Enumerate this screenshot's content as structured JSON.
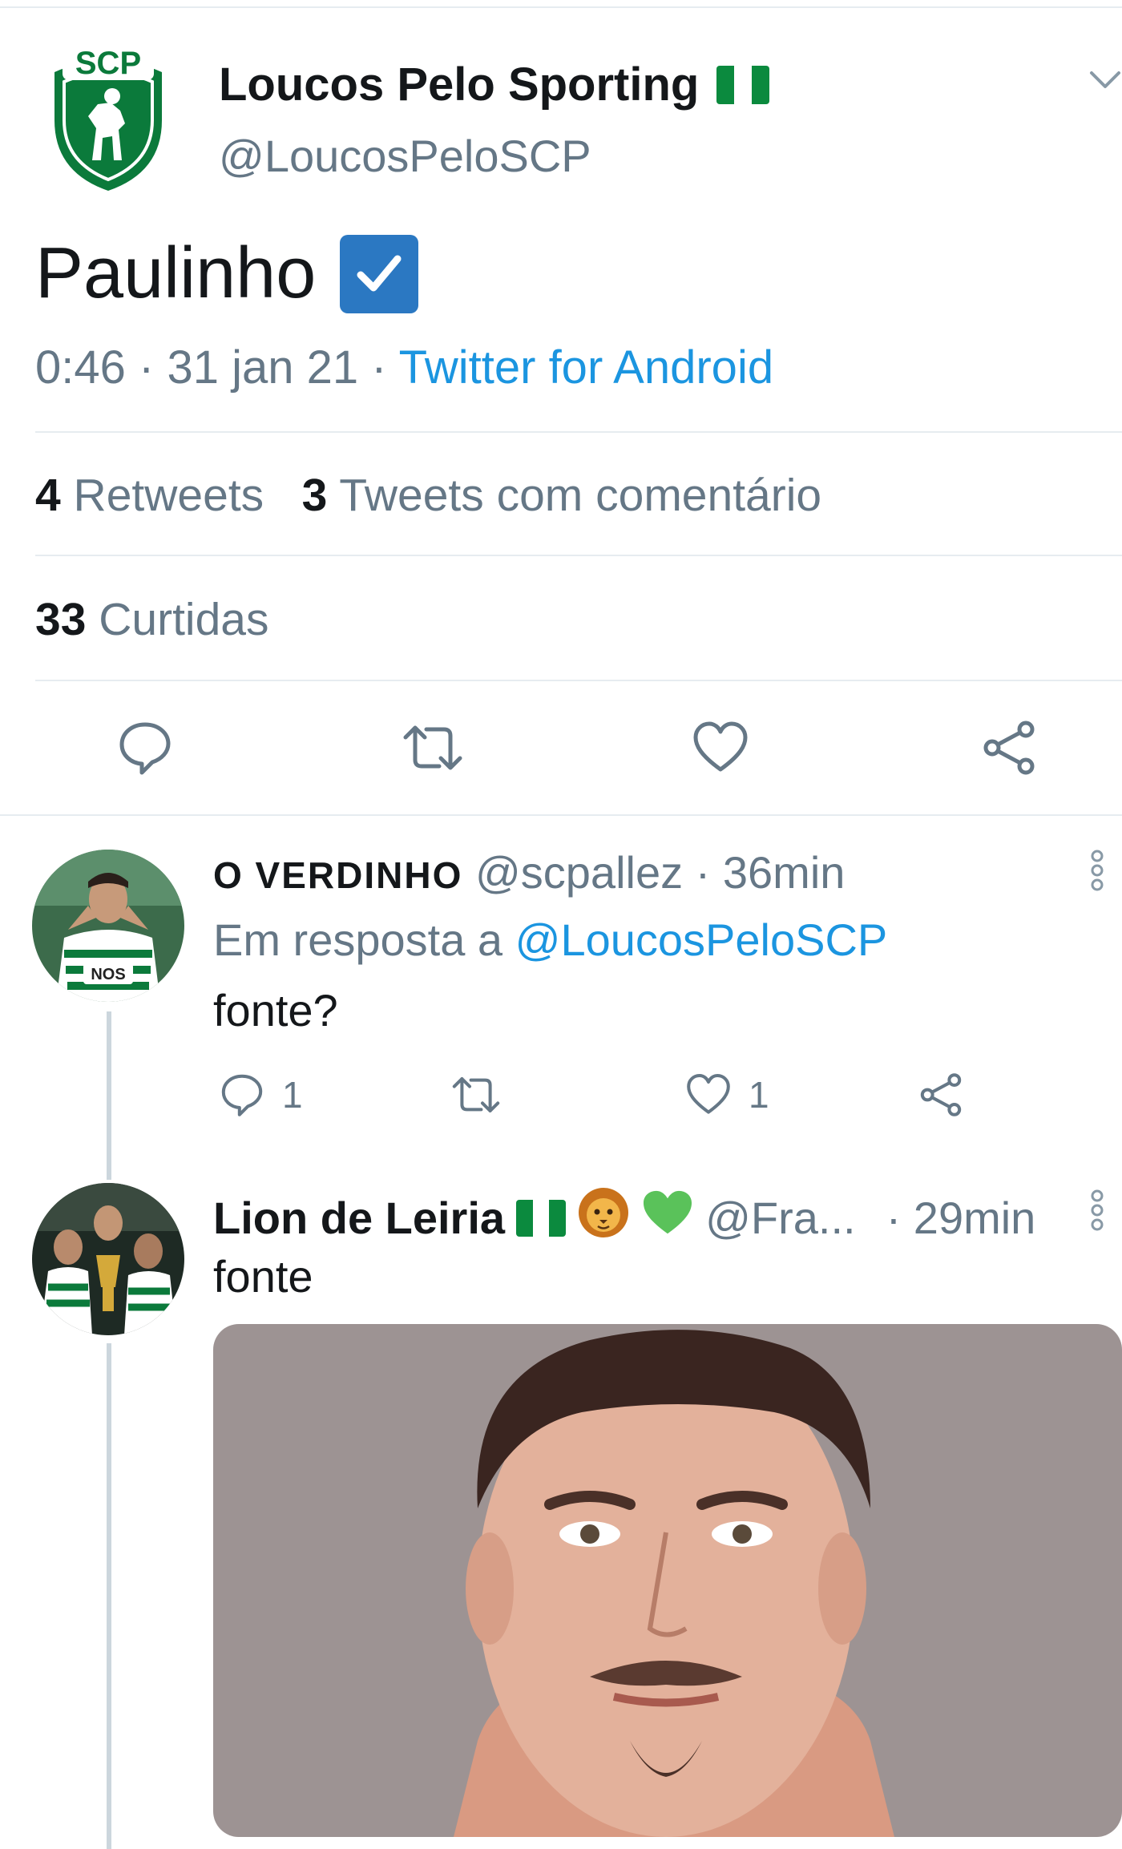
{
  "main_tweet": {
    "display_name": "Loucos Pelo Sporting",
    "handle": "@LoucosPeloSCP",
    "text": "Paulinho",
    "time": "0:46",
    "date": "31 jan 21",
    "separator": "·",
    "source": "Twitter for Android",
    "logo_text": "SCP",
    "stats": {
      "retweets_count": "4",
      "retweets_label": "Retweets",
      "quotes_count": "3",
      "quotes_label": "Tweets com comentário",
      "likes_count": "33",
      "likes_label": "Curtidas"
    }
  },
  "replies": [
    {
      "display_name": "O VERDINHO",
      "handle": "@scpallez",
      "time": "· 36min",
      "reply_to_label": "Em resposta a",
      "reply_to_handle": "@LoucosPeloSCP",
      "text": "fonte?",
      "reply_count": "1",
      "like_count": "1",
      "avatar_logo_text": "NOS"
    },
    {
      "display_name": "Lion de Leiria",
      "handle": "@Fra...",
      "time": "· 29min",
      "text": "fonte"
    }
  ],
  "icons": {
    "reply": "reply-icon",
    "retweet": "retweet-icon",
    "like": "heart-icon",
    "share": "share-icon",
    "more": "more-options-icon",
    "caret": "chevron-down-icon",
    "verified_check": "check-box-icon"
  },
  "colors": {
    "link": "#1b95e0",
    "muted": "#657786",
    "text": "#14171a",
    "sporting_green": "#0b7a3b",
    "check_blue": "#2b78c2"
  }
}
